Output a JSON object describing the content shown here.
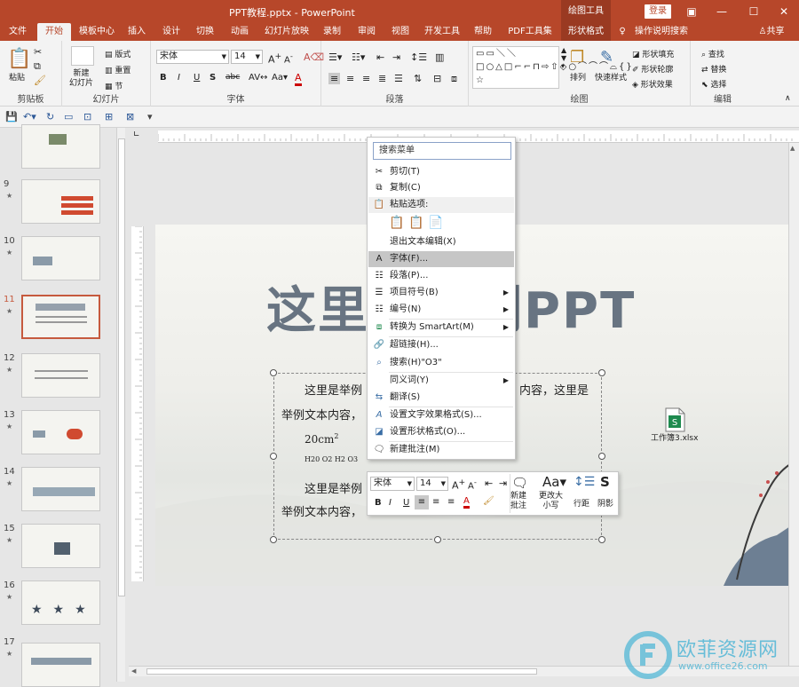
{
  "window": {
    "title": "PPT教程.pptx  -  PowerPoint",
    "context_group": "绘图工具",
    "login_label": "登录",
    "share_label": "共享",
    "help_label": "操作说明搜索"
  },
  "tabs": [
    "文件",
    "开始",
    "模板中心",
    "插入",
    "设计",
    "切换",
    "动画",
    "幻灯片放映",
    "录制",
    "审阅",
    "视图",
    "开发工具",
    "帮助",
    "PDF工具集",
    "形状格式"
  ],
  "active_tab": "开始",
  "ribbon": {
    "clipboard": {
      "paste": "粘贴",
      "label": "剪贴板"
    },
    "slides": {
      "new_slide": "新建\n幻灯片",
      "layout": "版式",
      "reset": "重置",
      "section": "节",
      "label": "幻灯片"
    },
    "font": {
      "name": "宋体",
      "size": "14",
      "label": "字体",
      "bold": "B",
      "italic": "I",
      "underline": "U",
      "shadow": "S",
      "strike": "abc"
    },
    "paragraph": {
      "label": "段落"
    },
    "drawing": {
      "arrange": "排列",
      "quick_styles": "快速样式",
      "fill": "形状填充",
      "outline": "形状轮廓",
      "effects": "形状效果",
      "label": "绘图"
    },
    "editing": {
      "find": "查找",
      "replace": "替换",
      "select": "选择",
      "label": "编辑"
    }
  },
  "thumbnails": [
    {
      "num": "",
      "star": ""
    },
    {
      "num": "9",
      "star": "★"
    },
    {
      "num": "10",
      "star": "★"
    },
    {
      "num": "11",
      "star": "★"
    },
    {
      "num": "12",
      "star": "★"
    },
    {
      "num": "13",
      "star": "★"
    },
    {
      "num": "14",
      "star": "★"
    },
    {
      "num": "15",
      "star": "★"
    },
    {
      "num": "16",
      "star": "★"
    },
    {
      "num": "17",
      "star": "★"
    }
  ],
  "selected_slide": "11",
  "slide": {
    "title": "这里是举例PPT",
    "line1": "这里是举例",
    "line1_tail": "内容，这里是",
    "line2": "举例文本内容，",
    "formula1": "20cm",
    "formula1_sup": "2",
    "formula2": "H20  O2  H2  O3",
    "line3": "这里是举例",
    "line4": "举例文本内容，",
    "attachment": "工作簿3.xlsx"
  },
  "context_menu": {
    "search_placeholder": "搜索菜单",
    "cut": "剪切(T)",
    "copy": "复制(C)",
    "paste_options": "粘贴选项:",
    "exit_edit": "退出文本编辑(X)",
    "font": "字体(F)...",
    "paragraph": "段落(P)...",
    "bullets": "项目符号(B)",
    "numbering": "编号(N)",
    "smartart": "转换为 SmartArt(M)",
    "hyperlink": "超链接(H)...",
    "search": "搜索(H)\"O3\"",
    "synonyms": "同义词(Y)",
    "translate": "翻译(S)",
    "text_effects": "设置文字效果格式(S)...",
    "shape_format": "设置形状格式(O)...",
    "new_comment": "新建批注(M)"
  },
  "mini_toolbar": {
    "font": "宋体",
    "size": "14",
    "new_comment": "新建\n批注",
    "change_case": "更改大\n小写",
    "line_spacing": "行距",
    "shadow": "阴影"
  },
  "watermark": {
    "brand": "欧菲资源网",
    "url": "www.office26.com"
  },
  "colors": {
    "accent": "#b7472a",
    "highlight": "#c6c6c6"
  }
}
